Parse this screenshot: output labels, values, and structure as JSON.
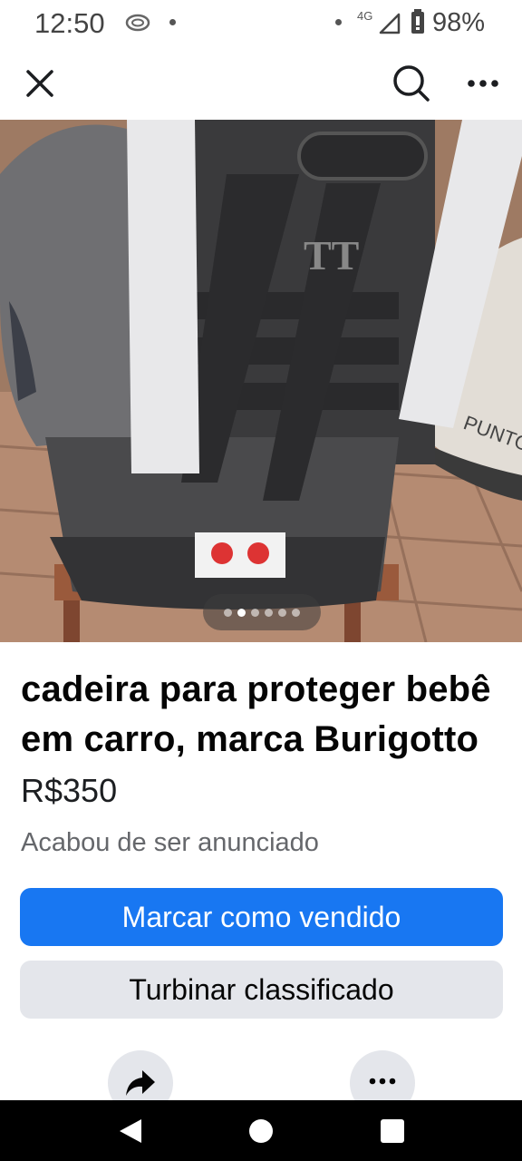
{
  "status_bar": {
    "time": "12:50",
    "network": "4G",
    "battery": "98%"
  },
  "top_bar": {
    "close_icon": "close-icon",
    "search_icon": "search-icon",
    "more_icon": "more-icon"
  },
  "photo": {
    "description_icon": "product-photo",
    "pager": {
      "count": 6,
      "active_index": 1
    }
  },
  "listing": {
    "title": "cadeira para proteger bebê em carro, marca Burigotto",
    "price": "R$350",
    "status": "Acabou de ser anunciado"
  },
  "actions": {
    "mark_sold": "Marcar como vendido",
    "boost": "Turbinar classificado",
    "share_icon": "share-icon",
    "more_icon": "more-icon"
  },
  "colors": {
    "primary": "#1877f2",
    "secondary_bg": "#e4e6eb",
    "muted_text": "#65676b"
  }
}
